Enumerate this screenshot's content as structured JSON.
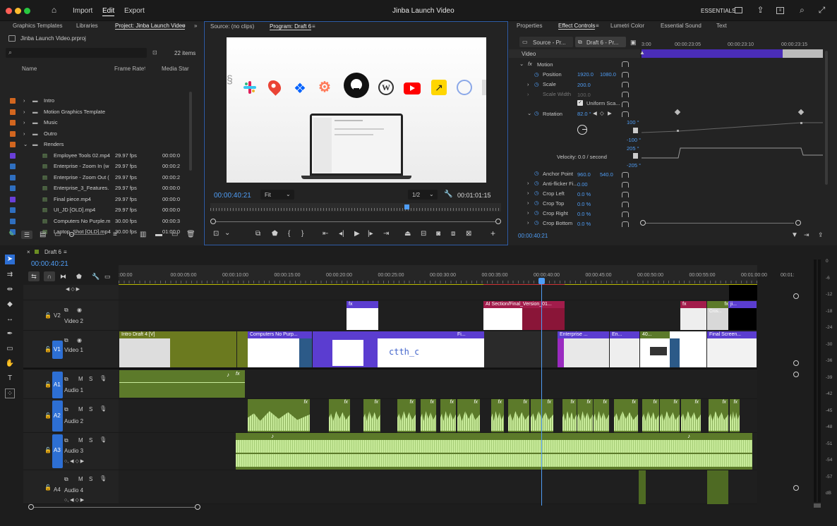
{
  "titlebar": {
    "menus": [
      "Import",
      "Edit",
      "Export"
    ],
    "active_menu": "Edit",
    "title": "Jinba Launch Video",
    "workspace": "ESSENTIALS"
  },
  "project_panel": {
    "tabs": [
      "Graphics Templates",
      "Libraries",
      "Project: Jinba Launch Video"
    ],
    "project_file": "Jinba Launch Video.prproj",
    "items_count": "22 items",
    "columns": {
      "name": "Name",
      "frame_rate": "Frame Rate",
      "media_start": "Media Star"
    },
    "items": [
      {
        "name": "Intro",
        "type": "folder",
        "color": "#d2661f",
        "fps": "",
        "start": ""
      },
      {
        "name": "Motion Graphics Template",
        "type": "folder",
        "color": "#d2661f",
        "fps": "",
        "start": ""
      },
      {
        "name": "Music",
        "type": "folder",
        "color": "#d2661f",
        "fps": "",
        "start": ""
      },
      {
        "name": "Outro",
        "type": "folder",
        "color": "#d2661f",
        "fps": "",
        "start": ""
      },
      {
        "name": "Renders",
        "type": "folder-open",
        "color": "#d2661f",
        "fps": "",
        "start": ""
      },
      {
        "name": "Employee Tools 02.mp4",
        "type": "clip",
        "color": "#6a3fd8",
        "fps": "29.97 fps",
        "start": "00:00:0"
      },
      {
        "name": "Enterprise - Zoom In (w",
        "type": "clip",
        "color": "#2f6fc0",
        "fps": "29.97 fps",
        "start": "00:00:2"
      },
      {
        "name": "Enterprise - Zoom Out (",
        "type": "clip",
        "color": "#2f6fc0",
        "fps": "29.97 fps",
        "start": "00:00:2"
      },
      {
        "name": "Enterprise_3_Features.",
        "type": "clip",
        "color": "#2f6fc0",
        "fps": "29.97 fps",
        "start": "00:00:0"
      },
      {
        "name": "Final piece.mp4",
        "type": "clip",
        "color": "#6a3fd8",
        "fps": "29.97 fps",
        "start": "00:00:0"
      },
      {
        "name": "UI_JD [OLD].mp4",
        "type": "clip",
        "color": "#2f6fc0",
        "fps": "29.97 fps",
        "start": "00:00:0"
      },
      {
        "name": "Computers No Purple.m",
        "type": "clip",
        "color": "#2f6fc0",
        "fps": "30.00 fps",
        "start": "00:00:3"
      },
      {
        "name": "Laptop_Shot [OLD].mp4",
        "type": "clip",
        "color": "#2f6fc0",
        "fps": "30.00 fps",
        "start": "01:00:0"
      }
    ]
  },
  "monitor": {
    "tabs": [
      "Source: (no clips)",
      "Program: Draft 6"
    ],
    "timecode": "00:00:40:21",
    "fit": "Fit",
    "resolution": "1/2",
    "duration": "00:01:01:15"
  },
  "effect_controls": {
    "tabs": [
      "Properties",
      "Effect Controls",
      "Lumetri Color",
      "Essential Sound",
      "Text"
    ],
    "source": "Source - Pr...",
    "sequence": "Draft 6 - Pr...",
    "ruler": [
      "3:00",
      "00:00:23:05",
      "00:00:23:10",
      "00:00:23:15"
    ],
    "section": "Video",
    "motion": "Motion",
    "position": {
      "label": "Position",
      "x": "1920.0",
      "y": "1080.0"
    },
    "scale": {
      "label": "Scale",
      "value": "200.0"
    },
    "scale_width": {
      "label": "Scale Width",
      "value": "100.0"
    },
    "uniform": "Uniform Sca...",
    "rotation": {
      "label": "Rotation",
      "value": "82.0 °"
    },
    "graph_top": "100 °",
    "graph_bottom": "-100 °",
    "velocity": "Velocity: 0.0 / second",
    "vel_top": "205 °",
    "vel_bottom": "-205 °",
    "anchor": {
      "label": "Anchor Point",
      "x": "960.0",
      "y": "540.0"
    },
    "antiflicker": {
      "label": "Anti-flicker Fi...",
      "value": "0.00"
    },
    "crop_left": {
      "label": "Crop Left",
      "value": "0.0 %"
    },
    "crop_top": {
      "label": "Crop Top",
      "value": "0.0 %"
    },
    "crop_right": {
      "label": "Crop Right",
      "value": "0.0 %"
    },
    "crop_bottom": {
      "label": "Crop Bottom",
      "value": "0.0 %"
    },
    "footer_time": "00:00:40:21"
  },
  "timeline": {
    "sequence": "Draft 6",
    "timecode": "00:00:40:21",
    "ruler": [
      ":00:00",
      "00:00:05:00",
      "00:00:10:00",
      "00:00:15:00",
      "00:00:20:00",
      "00:00:25:00",
      "00:00:30:00",
      "00:00:35:00",
      "00:00:40:00",
      "00:00:45:00",
      "00:00:50:00",
      "00:00:55:00",
      "00:01:00:00",
      "00:01:"
    ],
    "tracks": [
      {
        "id": "V2",
        "name": "Video 2"
      },
      {
        "id": "V1",
        "name": "Video 1"
      },
      {
        "id": "A1",
        "name": "Audio 1"
      },
      {
        "id": "A2",
        "name": "Audio 2"
      },
      {
        "id": "A3",
        "name": "Audio 3"
      },
      {
        "id": "A4",
        "name": "Audio 4"
      }
    ],
    "clips": {
      "intro": "Intro Draft 4 [V]",
      "computers": "Computers No Purp...",
      "ai_section": "AI Section/Final_Version_01...",
      "enterprise": "Enterprise ...",
      "en": "En...",
      "forty": "40...",
      "final_screen": "Final Screen...",
      "cros": "Cros...",
      "ji": "ji...",
      "fi": "Fi...",
      "code_text": "ctth_co"
    }
  },
  "meters": [
    "0",
    "-6",
    "-12",
    "-18",
    "-24",
    "-30",
    "-36",
    "-39",
    "-42",
    "-45",
    "-48",
    "-51",
    "-54",
    "-57",
    "dB"
  ],
  "colors": {
    "accent": "#4f9df5",
    "video_clip": "#5b3dd0",
    "audio_clip": "#5c7a2a",
    "wave": "#c8eb9a"
  }
}
